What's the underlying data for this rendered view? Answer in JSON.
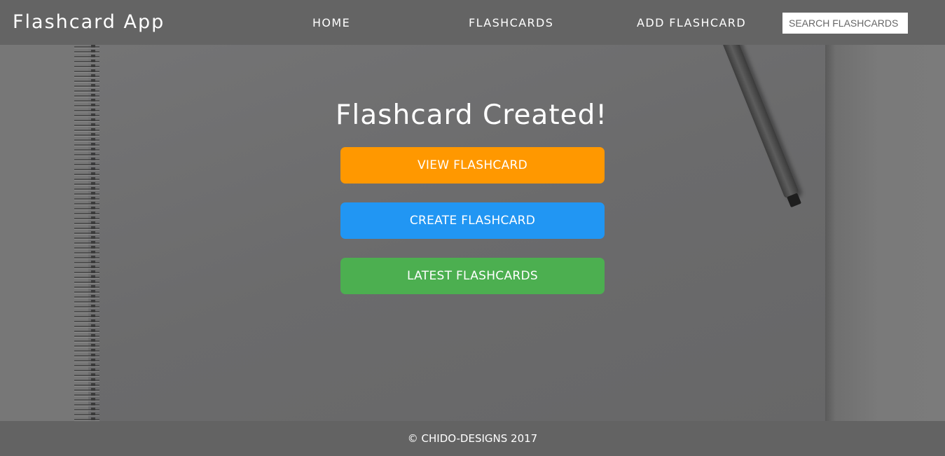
{
  "header": {
    "brand": "Flashcard App",
    "nav": {
      "home": "HOME",
      "flashcards": "FLASHCARDS",
      "add_flashcard": "ADD FLASHCARD"
    },
    "search": {
      "placeholder": "SEARCH FLASHCARDS",
      "value": ""
    }
  },
  "main": {
    "title": "Flashcard Created!",
    "buttons": {
      "view": "VIEW FLASHCARD",
      "create": "CREATE FLASHCARD",
      "latest": "LATEST FLASHCARDS"
    }
  },
  "footer": {
    "text": "© CHIDO-DESIGNS 2017"
  },
  "colors": {
    "header_bg": "#646464",
    "view_button": "#ff9800",
    "create_button": "#2196f3",
    "latest_button": "#4caf50",
    "footer_bg": "#636363"
  }
}
